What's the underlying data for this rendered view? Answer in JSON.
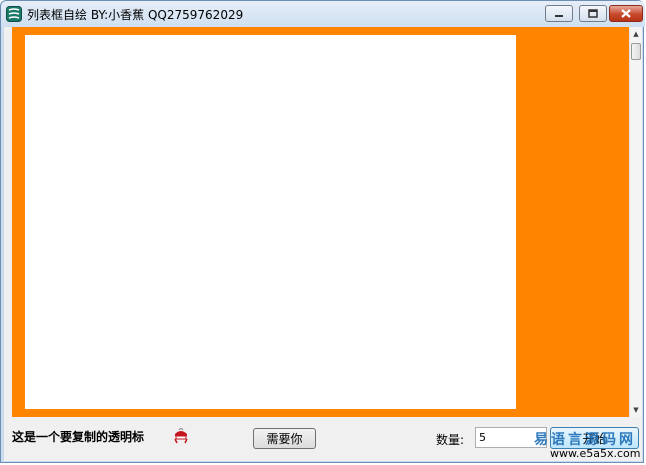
{
  "window": {
    "title": "列表框自绘   BY:小香蕉   QQ2759762029",
    "icon": "app-logo-icon",
    "controls": {
      "minimize_icon": "minimize-icon",
      "maximize_icon": "maximize-icon",
      "close_icon": "close-icon"
    }
  },
  "list": {
    "background_color": "#ff8400",
    "inner_color": "#ffffff",
    "scroll_up_glyph": "▲",
    "scroll_down_glyph": "▼"
  },
  "bottom": {
    "label": "这是一个要复制的透明标",
    "icon": "red-figure-icon",
    "need_button_label": "需要你",
    "quantity_label": "数量:",
    "quantity_value": "5",
    "start_button_label": "开始"
  },
  "watermark": {
    "chinese": "易语言源码网",
    "url": "www.e5a5x.com",
    "color": "#1e6fb8"
  }
}
